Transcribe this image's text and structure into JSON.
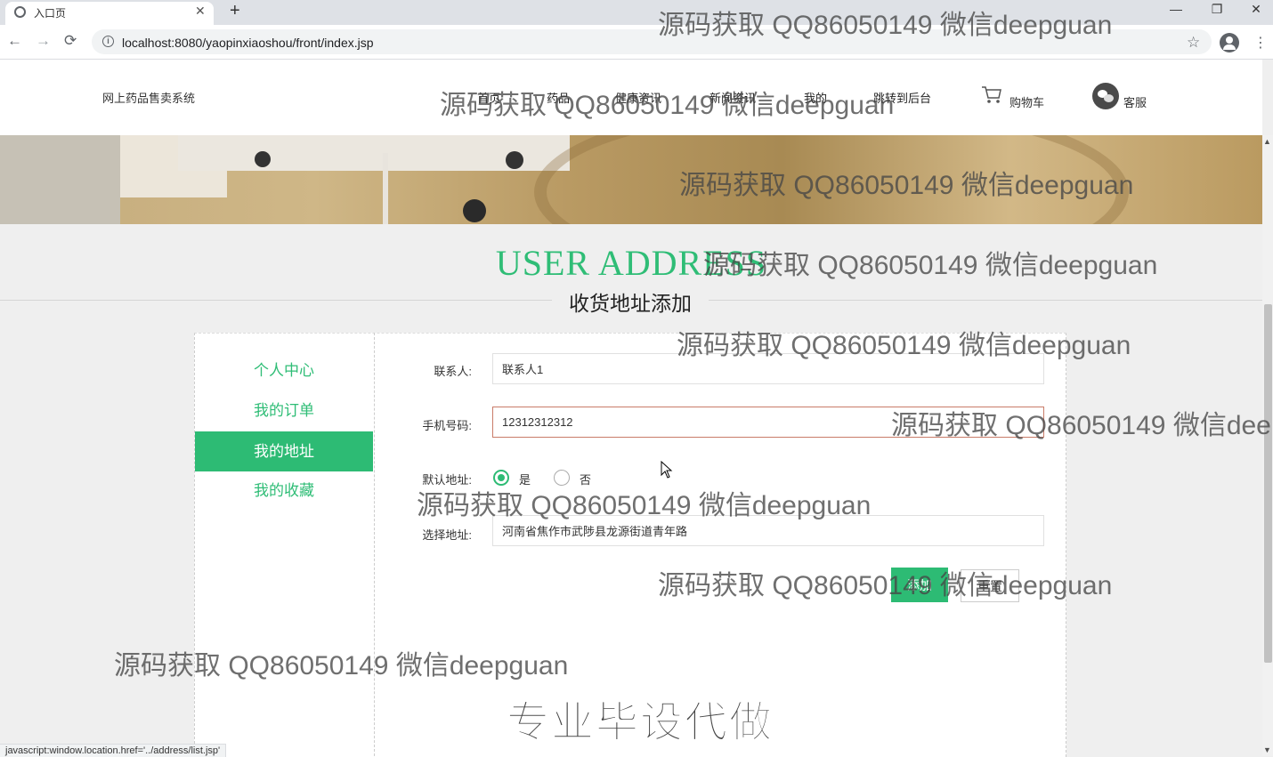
{
  "browser": {
    "tab_title": "入口页",
    "tab_close": "✕",
    "new_tab": "+",
    "url": "localhost:8080/yaopinxiaoshou/front/index.jsp",
    "back": "←",
    "forward": "→",
    "reload": "⟳",
    "star": "☆",
    "menu": "⋮",
    "minimize": "—",
    "restore": "❐",
    "close": "✕",
    "status_url": "javascript:window.location.href='../address/list.jsp'"
  },
  "header": {
    "site_title": "网上药品售卖系统",
    "nav": [
      "首页",
      "药品",
      "健康资讯",
      "新闻资讯",
      "我的",
      "跳转到后台"
    ],
    "cart_label": "购物车",
    "service_label": "客服"
  },
  "section": {
    "en_title": "USER ADDRESS",
    "cn_title": "收货地址添加"
  },
  "sidebar": {
    "items": [
      {
        "label": "个人中心",
        "active": false
      },
      {
        "label": "我的订单",
        "active": false
      },
      {
        "label": "我的地址",
        "active": true
      },
      {
        "label": "我的收藏",
        "active": false
      }
    ]
  },
  "form": {
    "contact_label": "联系人:",
    "contact_value": "联系人1",
    "phone_label": "手机号码:",
    "phone_value": "12312312312",
    "default_label": "默认地址:",
    "default_yes": "是",
    "default_no": "否",
    "default_selected": "是",
    "address_label": "选择地址:",
    "address_value": "河南省焦作市武陟县龙源街道青年路",
    "add_button": "添加",
    "reset_button": "重置"
  },
  "watermark": {
    "text": "源码获取 QQ86050149 微信deepguan",
    "text_cut": "源码获取 QQ86050149 微信dee",
    "promo": "专业毕设代做"
  },
  "colors": {
    "accent": "#2dbb74",
    "focus_border": "#c97c69"
  }
}
